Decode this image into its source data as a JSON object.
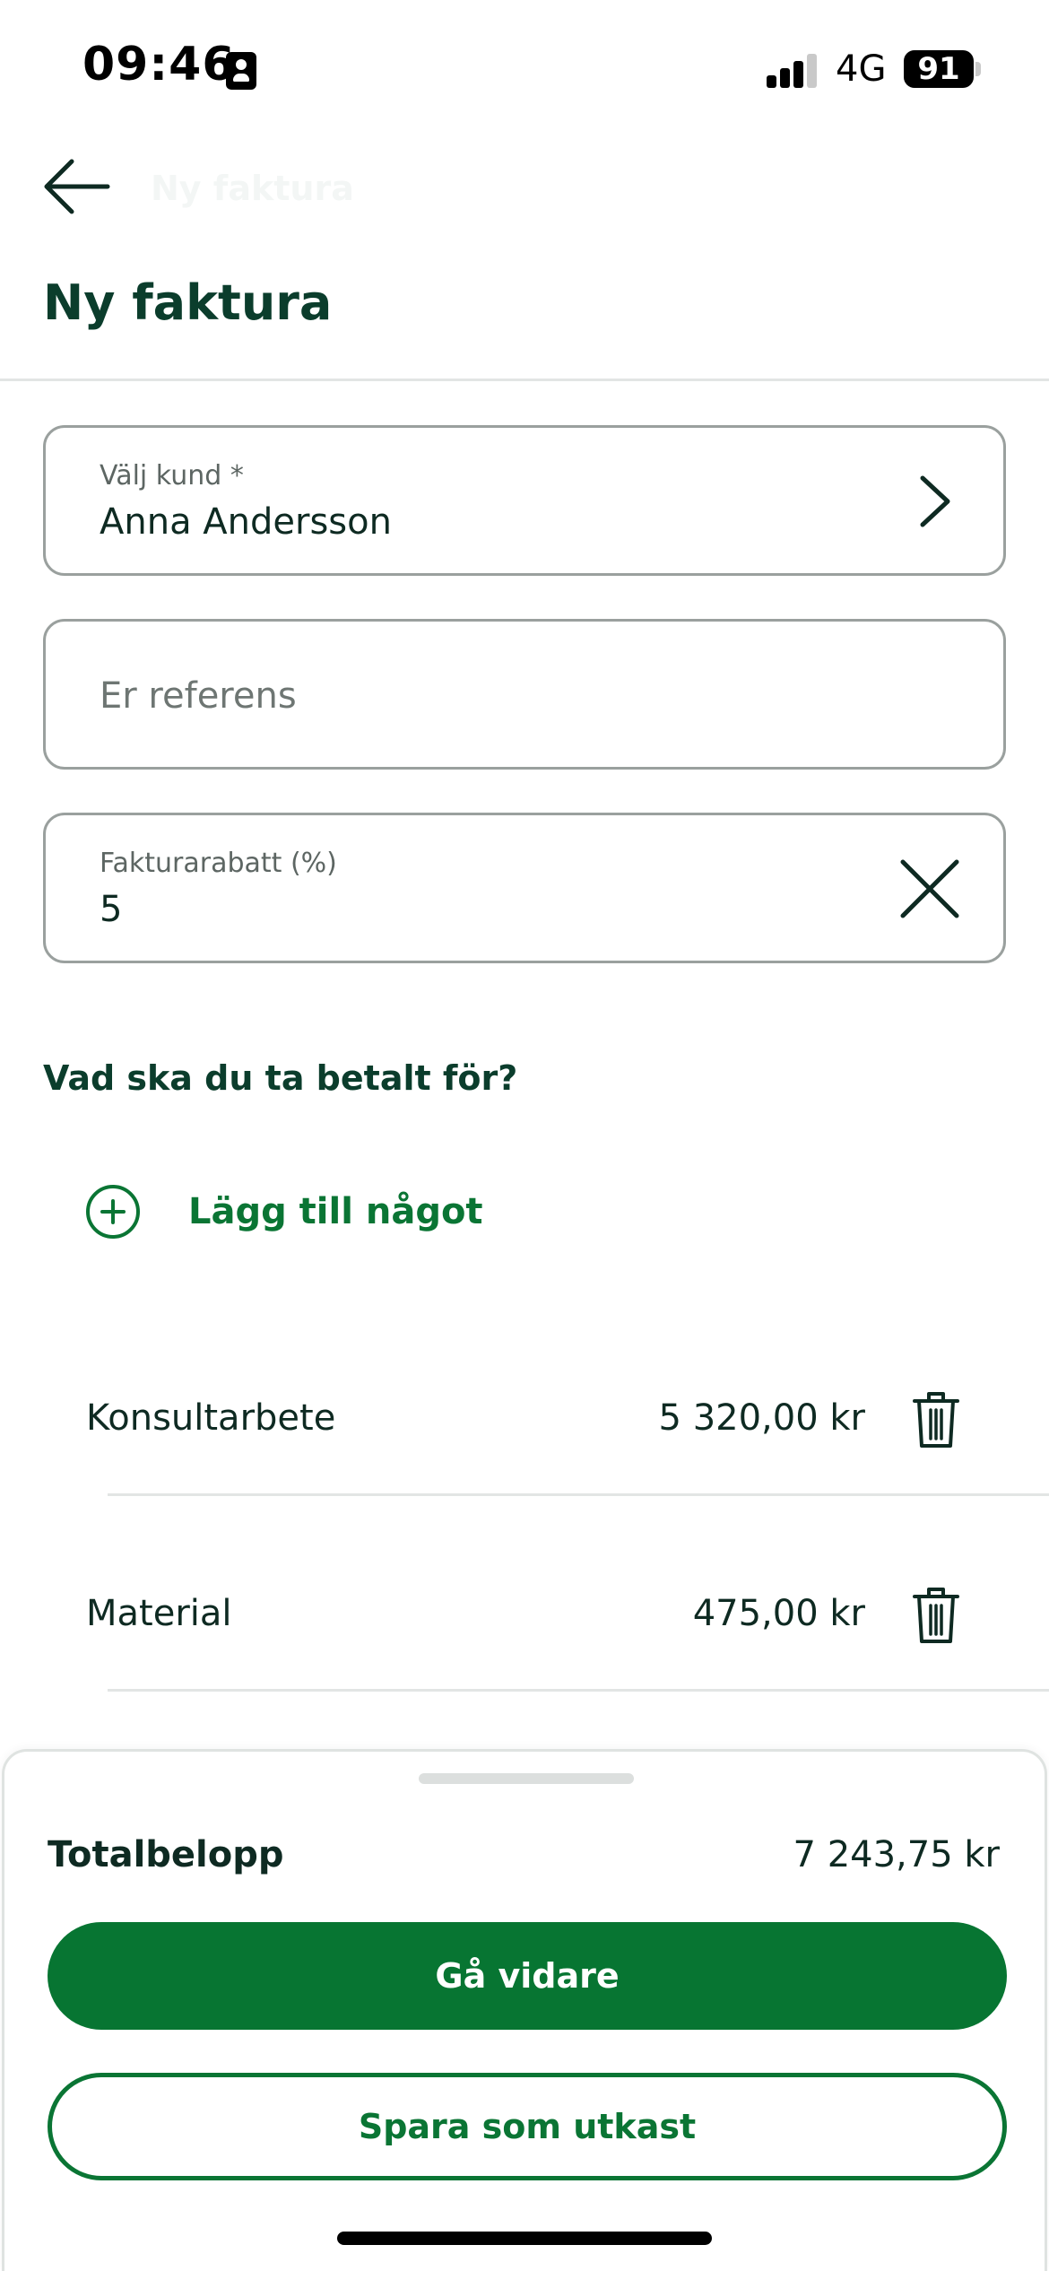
{
  "status_bar": {
    "time": "09:46",
    "network": "4G",
    "battery": "91",
    "icons": [
      "id-card-icon",
      "signal-icon",
      "battery-icon"
    ]
  },
  "header": {
    "back_icon": "arrow-left-icon",
    "faint_title": "Ny faktura",
    "title": "Ny faktura"
  },
  "form": {
    "customer": {
      "label": "Välj kund *",
      "value": "Anna Andersson",
      "icon": "chevron-right-icon"
    },
    "reference": {
      "placeholder": "Er referens"
    },
    "discount": {
      "label": "Fakturarabatt (%)",
      "value": "5",
      "icon": "close-icon"
    }
  },
  "items_section": {
    "title": "Vad ska du ta betalt för?",
    "add_label": "Lägg till något",
    "add_icon": "plus-circle-icon",
    "items": [
      {
        "name": "Konsultarbete",
        "amount": "5 320,00 kr",
        "icon": "trash-icon"
      },
      {
        "name": "Material",
        "amount": "475,00 kr",
        "icon": "trash-icon"
      }
    ]
  },
  "summary": {
    "total_label": "Totalbelopp",
    "total_value": "7 243,75 kr",
    "primary_label": "Gå vidare",
    "secondary_label": "Spara som utkast"
  },
  "colors": {
    "brand_green": "#077532",
    "title_green": "#0b3d2c",
    "border_gray": "#9aa09e",
    "divider": "#e2e5e4"
  }
}
